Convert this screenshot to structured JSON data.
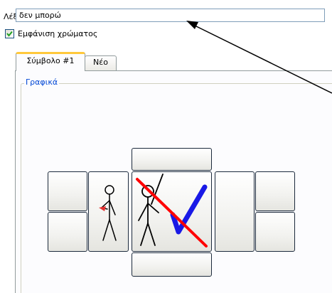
{
  "word": {
    "label": "Λέξη",
    "value": "δεν μπορώ"
  },
  "show_color": {
    "label": "Εμφάνιση χρώματος",
    "checked": true
  },
  "tabs": [
    {
      "label": "Σύμβολο #1",
      "active": true
    },
    {
      "label": "Νέο",
      "active": false
    }
  ],
  "group": {
    "title": "Γραφικά"
  },
  "colors": {
    "accent_tab": "#ffc83c",
    "group_title": "#0046d5",
    "check": "#21a121",
    "cross": "#ff0000",
    "tick": "#1919e6"
  },
  "icons": {
    "center": "cannot-pictogram-icon",
    "left": "person-pointing-pictogram-icon"
  }
}
